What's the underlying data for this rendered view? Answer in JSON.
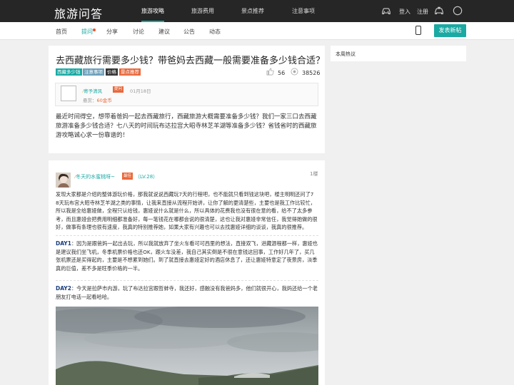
{
  "header": {
    "logo": "旅游问答",
    "nav": [
      "旅游攻略",
      "旅游费用",
      "景点推荐",
      "注意事项"
    ],
    "login": "登入",
    "register": "注册"
  },
  "subnav": {
    "items": [
      "首页",
      "提问",
      "分享",
      "讨论",
      "建议",
      "公告",
      "动态"
    ],
    "post_button": "发表新帖"
  },
  "question": {
    "title": "去西藏旅行需要多少钱？带爸妈去西藏一般需要准备多少钱合适？",
    "tags": [
      {
        "label": "西藏多少钱",
        "color": "#1aa9a3"
      },
      {
        "label": "注意事项",
        "color": "#6d9fbb"
      },
      {
        "label": "价格",
        "color": "#333333"
      },
      {
        "label": "景点推荐",
        "color": "#e8693d"
      }
    ],
    "likes": "56",
    "views": "38526",
    "asker": {
      "name": "寄予清风",
      "badge": "提问",
      "date": "01月18日",
      "bounty_label": "悬赏：",
      "bounty_value": "60金币"
    },
    "body": "最近时间得空，想带着爸妈一起去西藏旅行，西藏旅游大概需要准备多少钱？我们一家三口去西藏旅游准备多少钱合适？七八天的时间玩布达拉宫大昭寺林芝羊湖等准备多少钱？省钱省时的西藏旅游攻略诚心求一份靠谱的！"
  },
  "sidebar": {
    "title": "本周热议"
  },
  "answer": {
    "name": "冬天的水蜜桃呀~",
    "badge": "最佳",
    "level": "（LV.28）",
    "floor": "1楼",
    "intro": "发现大家都是介绍的整体游玩价格，那我就说说西藏玩7天的行程吧，也不能就只看到钱这块吧，楼主明明还问了7 8天玩布宫大昭寺林芝羊湖之类的事情，让我来直接从流程开始讲，让你了解的更清楚些，主要也是我工作比较忙，所以我是全给惠娅做，全程只认给钱，惠娅说什么就是什么，所以具体的花费我也没有很在意的看，给不了太多参考，而且惠娅会把费用明细都准备好，每一笔钱花在哪都会说的很清楚，这也让我对惠娅非常信任，我觉得她做的很好，做事有条理也很有速度，我真的特别推荐她，如果大家有兴趣也可以去找惠娅详细的谈谈，我真的很推荐。",
    "day1_label": "DAY1",
    "day1_text": "：因为是跟爸妈一起出去玩，所以我就放弃了坐火车看可可西里的想法，直接双飞，进藏源程都一样，惠娅也是建议我们坐飞机，冬季机票价格也还OK，跟火车没差，我自己其实倒是不很在意钱这回事，工作好几年了，买几张机票还是买得起的，主要是不想累到她们。到了就直接去惠娅定好的酒店休息了，还让惠娅特意定了夜景房，淡季真的巨值，差不多是旺季价格的一半。",
    "day2_label": "DAY2",
    "day2_text": "：今天是拉萨市内游，玩了布达拉宫跟哲蚌寺，我还好，感触没有我爸妈多，他们就很开心，我妈还给一个老朋友打电话一起看哈哈。"
  }
}
